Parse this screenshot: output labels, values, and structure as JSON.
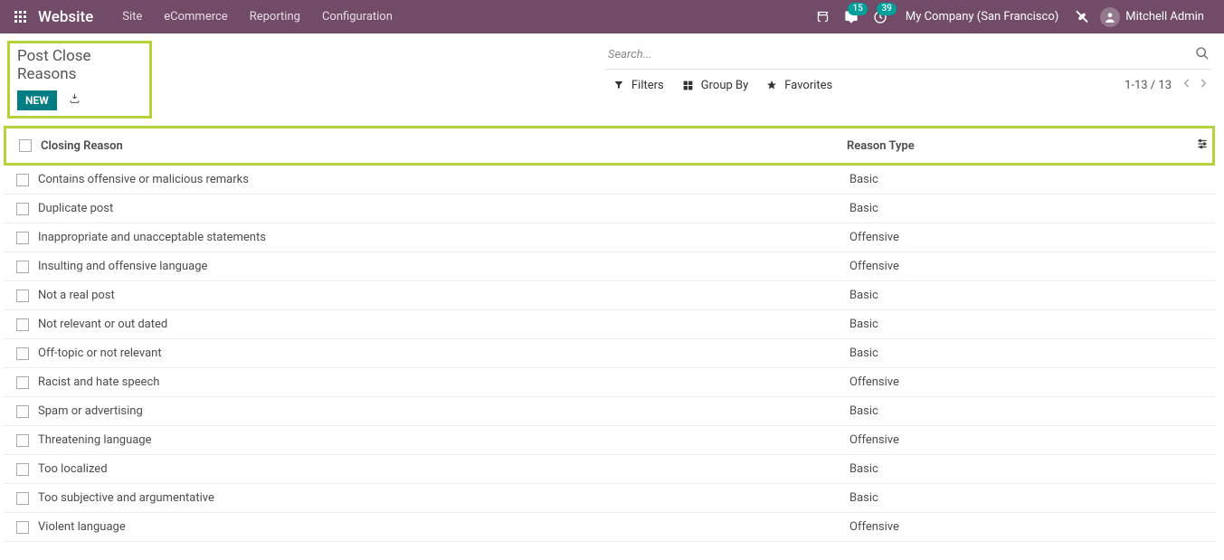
{
  "topbar": {
    "brand": "Website",
    "nav": [
      "Site",
      "eCommerce",
      "Reporting",
      "Configuration"
    ],
    "chat_badge": "15",
    "clock_badge": "39",
    "company": "My Company (San Francisco)",
    "user": "Mitchell Admin"
  },
  "header": {
    "title": "Post Close Reasons",
    "new_btn": "NEW"
  },
  "search": {
    "placeholder": "Search..."
  },
  "toolbar": {
    "filters": "Filters",
    "groupby": "Group By",
    "favorites": "Favorites",
    "pager": "1-13 / 13"
  },
  "columns": {
    "reason": "Closing Reason",
    "type": "Reason Type"
  },
  "rows": [
    {
      "reason": "Contains offensive or malicious remarks",
      "type": "Basic"
    },
    {
      "reason": "Duplicate post",
      "type": "Basic"
    },
    {
      "reason": "Inappropriate and unacceptable statements",
      "type": "Offensive"
    },
    {
      "reason": "Insulting and offensive language",
      "type": "Offensive"
    },
    {
      "reason": "Not a real post",
      "type": "Basic"
    },
    {
      "reason": "Not relevant or out dated",
      "type": "Basic"
    },
    {
      "reason": "Off-topic or not relevant",
      "type": "Basic"
    },
    {
      "reason": "Racist and hate speech",
      "type": "Offensive"
    },
    {
      "reason": "Spam or advertising",
      "type": "Basic"
    },
    {
      "reason": "Threatening language",
      "type": "Offensive"
    },
    {
      "reason": "Too localized",
      "type": "Basic"
    },
    {
      "reason": "Too subjective and argumentative",
      "type": "Basic"
    },
    {
      "reason": "Violent language",
      "type": "Offensive"
    }
  ]
}
